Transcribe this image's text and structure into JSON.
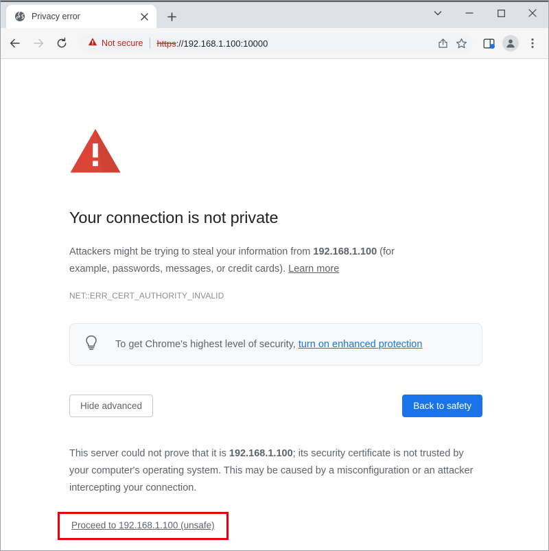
{
  "window": {
    "controls": {
      "chevron_down": "chevron-down",
      "minimize": "minimize",
      "maximize": "maximize",
      "close": "close"
    }
  },
  "tabstrip": {
    "tabs": [
      {
        "title": "Privacy error",
        "favicon": "globe-icon",
        "close_label": "×"
      }
    ],
    "new_tab_label": "+"
  },
  "toolbar": {
    "back_label": "back-icon",
    "forward_label": "forward-icon",
    "reload_label": "reload-icon",
    "omnibox": {
      "security_label": "Not secure",
      "security_color": "#c5221f",
      "url_scheme": "https",
      "url_rest": "://192.168.1.100:10000",
      "full_url": "https://192.168.1.100:10000"
    },
    "actions": [
      {
        "name": "share-icon"
      },
      {
        "name": "bookmark-star-icon"
      },
      {
        "name": "side-panel-icon",
        "badge": true
      },
      {
        "name": "profile-avatar-icon"
      },
      {
        "name": "three-dot-menu-icon"
      }
    ]
  },
  "interstitial": {
    "icon": "red-warning-triangle-icon",
    "icon_color": "#db4437",
    "heading": "Your connection is not private",
    "body_prefix": "Attackers might be trying to steal your information from ",
    "body_host": "192.168.1.100",
    "body_suffix": " (for example, passwords, messages, or credit cards). ",
    "learn_more": "Learn more",
    "error_code": "NET::ERR_CERT_AUTHORITY_INVALID",
    "callout": {
      "icon": "lightbulb-icon",
      "text": "To get Chrome's highest level of security, ",
      "link": "turn on enhanced protection",
      "link_color": "#1a73e8"
    },
    "buttons": {
      "advanced_label": "Hide advanced",
      "safety_label": "Back to safety",
      "safety_color": "#1a73e8"
    },
    "advanced": {
      "prefix": "This server could not prove that it is ",
      "host": "192.168.1.100",
      "suffix": "; its security certificate is not trusted by your computer's operating system. This may be caused by a misconfiguration or an attacker intercepting your connection.",
      "proceed_link": "Proceed to 192.168.1.100 (unsafe)",
      "highlight_color": "#e8000d"
    }
  }
}
